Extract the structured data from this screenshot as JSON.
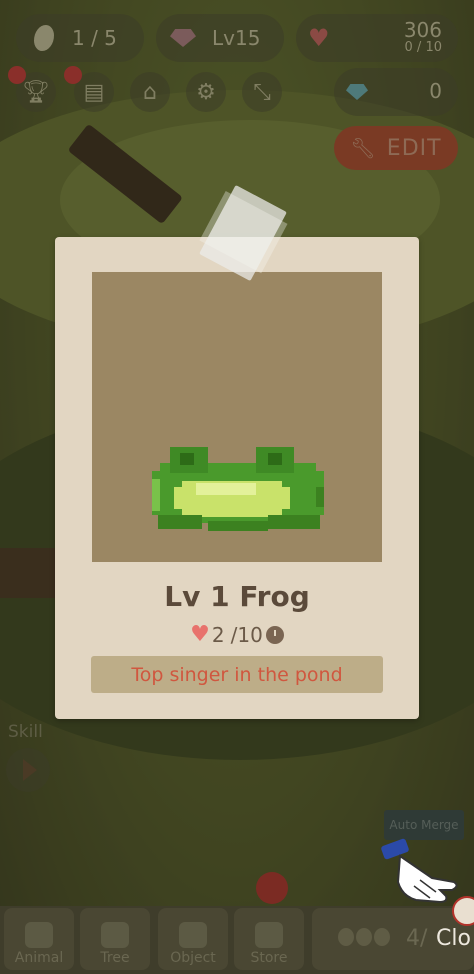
{
  "hud": {
    "leaves": "1 / 5",
    "level": "Lv15",
    "hearts": "306",
    "hearts_sub": "0 / 10",
    "gems": "0",
    "edit_label": "EDIT"
  },
  "card": {
    "title": "Lv 1 Frog",
    "hearts_count": "2",
    "timer_value": "/10",
    "description": "Top singer in the pond"
  },
  "skill": {
    "label": "Skill"
  },
  "auto_merge_label": "Auto Merge",
  "tabs": [
    {
      "label": "Animal"
    },
    {
      "label": "Tree"
    },
    {
      "label": "Object"
    },
    {
      "label": "Store"
    }
  ],
  "count_text": "4/",
  "close_text": "Clo",
  "colors": {
    "card_bg": "#e2d6c2",
    "portrait_bg": "#9b8763",
    "desc_bg": "#bdad88",
    "desc_text": "#d0573f",
    "frog_green": "#4a9a2c",
    "frog_belly": "#c9e26a"
  },
  "icons": [
    "leaf-icon",
    "gem-icon",
    "heart-icon",
    "diamond-icon",
    "trophy-icon",
    "book-icon",
    "shop-icon",
    "gear-icon",
    "shrink-icon",
    "wrench-icon",
    "timer-icon",
    "hand-pointer-icon"
  ]
}
